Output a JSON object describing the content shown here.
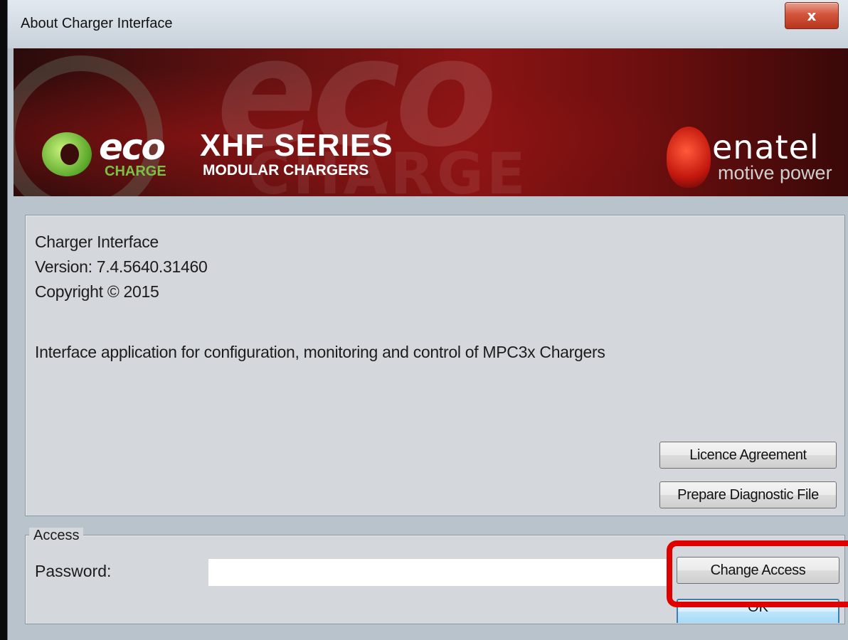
{
  "window": {
    "title": "About Charger Interface",
    "close_glyph": "x"
  },
  "banner": {
    "eco_word": "eco",
    "charge_word": "CHARGE",
    "series_title": "XHF SERIES",
    "series_subtitle": "MODULAR CHARGERS",
    "brand_name": "enatel",
    "brand_tagline": "motive power",
    "watermark_text": "eco",
    "watermark_text2": "CHARGE"
  },
  "about": {
    "product": "Charger Interface",
    "version": "Version: 7.4.5640.31460",
    "copyright": "Copyright © 2015",
    "description": "Interface application for configuration, monitoring and control of MPC3x Chargers"
  },
  "buttons": {
    "licence": "Licence Agreement",
    "diagnostic": "Prepare Diagnostic File",
    "change_access": "Change Access",
    "ok": "OK"
  },
  "access": {
    "group_label": "Access",
    "password_label": "Password:",
    "password_value": ""
  },
  "colors": {
    "highlight": "#e00000"
  }
}
